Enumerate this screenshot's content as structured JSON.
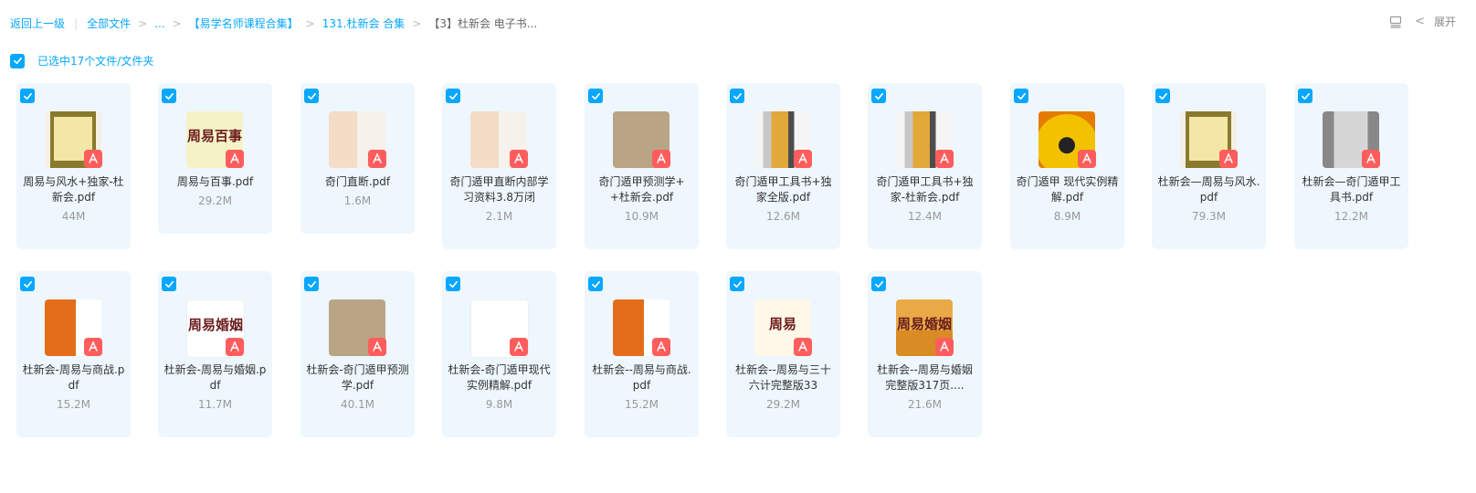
{
  "breadcrumb": {
    "back": "返回上一级",
    "items": [
      "全部文件",
      "...",
      "【易学名师课程合集】",
      "131.杜新会 合集",
      "【3】杜新会 电子书..."
    ]
  },
  "toolbar": {
    "expand_label": "展开"
  },
  "selection": {
    "label": "已选中17个文件/文件夹"
  },
  "colors": {
    "accent": "#06a7ff",
    "card_bg": "#eef7fe",
    "pdf_badge": "#ff5d5d"
  },
  "files": [
    {
      "name": "周易与风水+独家-杜新会.pdf",
      "size": "44M",
      "thumb": "book-olive",
      "thumb_text": ""
    },
    {
      "name": "周易与百事.pdf",
      "size": "29.2M",
      "thumb": "yellow",
      "thumb_text": "周易百事"
    },
    {
      "name": "奇门直断.pdf",
      "size": "1.6M",
      "thumb": "beige",
      "thumb_text": ""
    },
    {
      "name": "奇门遁甲直断内部学习资料3.8万闭",
      "size": "2.1M",
      "thumb": "beige",
      "thumb_text": ""
    },
    {
      "name": "奇门遁甲预测学++杜新会.pdf",
      "size": "10.9M",
      "thumb": "brown",
      "thumb_text": ""
    },
    {
      "name": "奇门遁甲工具书+独家全版.pdf",
      "size": "12.6M",
      "thumb": "photo",
      "thumb_text": ""
    },
    {
      "name": "奇门遁甲工具书+独家-杜新会.pdf",
      "size": "12.4M",
      "thumb": "photo",
      "thumb_text": ""
    },
    {
      "name": "奇门遁甲 现代实例精解.pdf",
      "size": "8.9M",
      "thumb": "gold",
      "thumb_text": ""
    },
    {
      "name": "杜新会—周易与风水.pdf",
      "size": "79.3M",
      "thumb": "book-olive",
      "thumb_text": ""
    },
    {
      "name": "杜新会—奇门遁甲工具书.pdf",
      "size": "12.2M",
      "thumb": "gray",
      "thumb_text": ""
    },
    {
      "name": "杜新会-周易与商战.pdf",
      "size": "15.2M",
      "thumb": "orange",
      "thumb_text": ""
    },
    {
      "name": "杜新会-周易与婚姻.pdf",
      "size": "11.7M",
      "thumb": "white",
      "thumb_text": "周易婚姻"
    },
    {
      "name": "杜新会-奇门遁甲预测学.pdf",
      "size": "40.1M",
      "thumb": "brown",
      "thumb_text": ""
    },
    {
      "name": "杜新会-奇门遁甲现代实例精解.pdf",
      "size": "9.8M",
      "thumb": "white",
      "thumb_text": ""
    },
    {
      "name": "杜新会--周易与商战.pdf",
      "size": "15.2M",
      "thumb": "orange",
      "thumb_text": ""
    },
    {
      "name": "杜新会--周易与三十六计完整版33",
      "size": "29.2M",
      "thumb": "cream",
      "thumb_text": "周易"
    },
    {
      "name": "杜新会--周易与婚姻完整版317页....",
      "size": "21.6M",
      "thumb": "amber",
      "thumb_text": "周易婚姻"
    }
  ]
}
